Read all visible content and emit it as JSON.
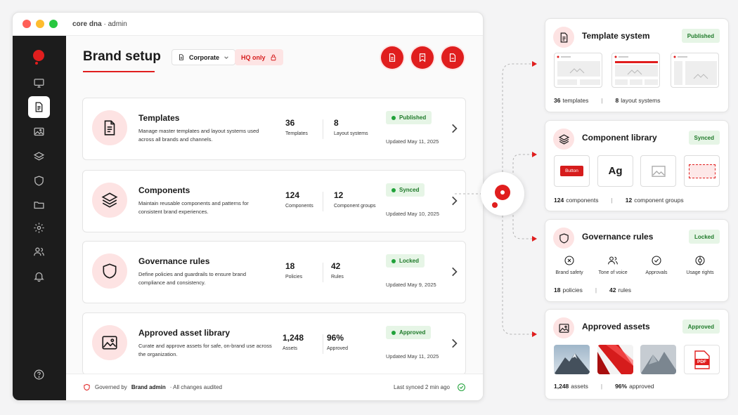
{
  "window": {
    "app": "core dna",
    "section": "admin",
    "separator": " · "
  },
  "header": {
    "title": "Brand setup",
    "workspace": "Corporate",
    "scope": "HQ only"
  },
  "cards": [
    {
      "title": "Templates",
      "desc": "Manage master templates and layout systems used across all brands and channels.",
      "stat1_value": "36",
      "stat1_label": "Templates",
      "stat2_value": "8",
      "stat2_label": "Layout systems",
      "status": "Published",
      "updated": "Updated May 11, 2025"
    },
    {
      "title": "Components",
      "desc": "Maintain reusable components and patterns for consistent brand experiences.",
      "stat1_value": "124",
      "stat1_label": "Components",
      "stat2_value": "12",
      "stat2_label": "Component groups",
      "status": "Synced",
      "updated": "Updated May 10, 2025"
    },
    {
      "title": "Governance rules",
      "desc": "Define policies and guardrails to ensure brand compliance and consistency.",
      "stat1_value": "18",
      "stat1_label": "Policies",
      "stat2_value": "42",
      "stat2_label": "Rules",
      "status": "Locked",
      "updated": "Updated May 9, 2025"
    },
    {
      "title": "Approved asset library",
      "desc": "Curate and approve assets for safe, on-brand use across the organization.",
      "stat1_value": "1,248",
      "stat1_label": "Assets",
      "stat2_value": "96%",
      "stat2_label": "Approved",
      "status": "Approved",
      "updated": "Updated May 11, 2025"
    }
  ],
  "footer": {
    "governed_prefix": "Governed by",
    "governed_by": "Brand admin",
    "audit": "· All changes audited",
    "synced": "Last synced 2 min ago"
  },
  "panels": {
    "templates": {
      "title": "Template system",
      "status": "Published",
      "stat1_value": "36",
      "stat1_label": "templates",
      "stat2_value": "8",
      "stat2_label": "layout systems"
    },
    "components": {
      "title": "Component library",
      "status": "Synced",
      "button_label": "Button",
      "type_sample": "Ag",
      "stat1_value": "124",
      "stat1_label": "components",
      "stat2_value": "12",
      "stat2_label": "component groups"
    },
    "governance": {
      "title": "Governance rules",
      "status": "Locked",
      "rules": [
        "Brand safety",
        "Tone of voice",
        "Approvals",
        "Usage rights"
      ],
      "stat1_value": "18",
      "stat1_label": "policies",
      "stat2_value": "42",
      "stat2_label": "rules"
    },
    "assets": {
      "title": "Approved assets",
      "status": "Approved",
      "pdf_label": "PDF",
      "stat1_value": "1,248",
      "stat1_label": "assets",
      "stat2_value": "96%",
      "stat2_label": "approved"
    }
  },
  "colors": {
    "accent": "#e01e1e",
    "accent_soft": "#fde3e3",
    "success": "#21a23a",
    "sidebar": "#1c1c1c"
  }
}
